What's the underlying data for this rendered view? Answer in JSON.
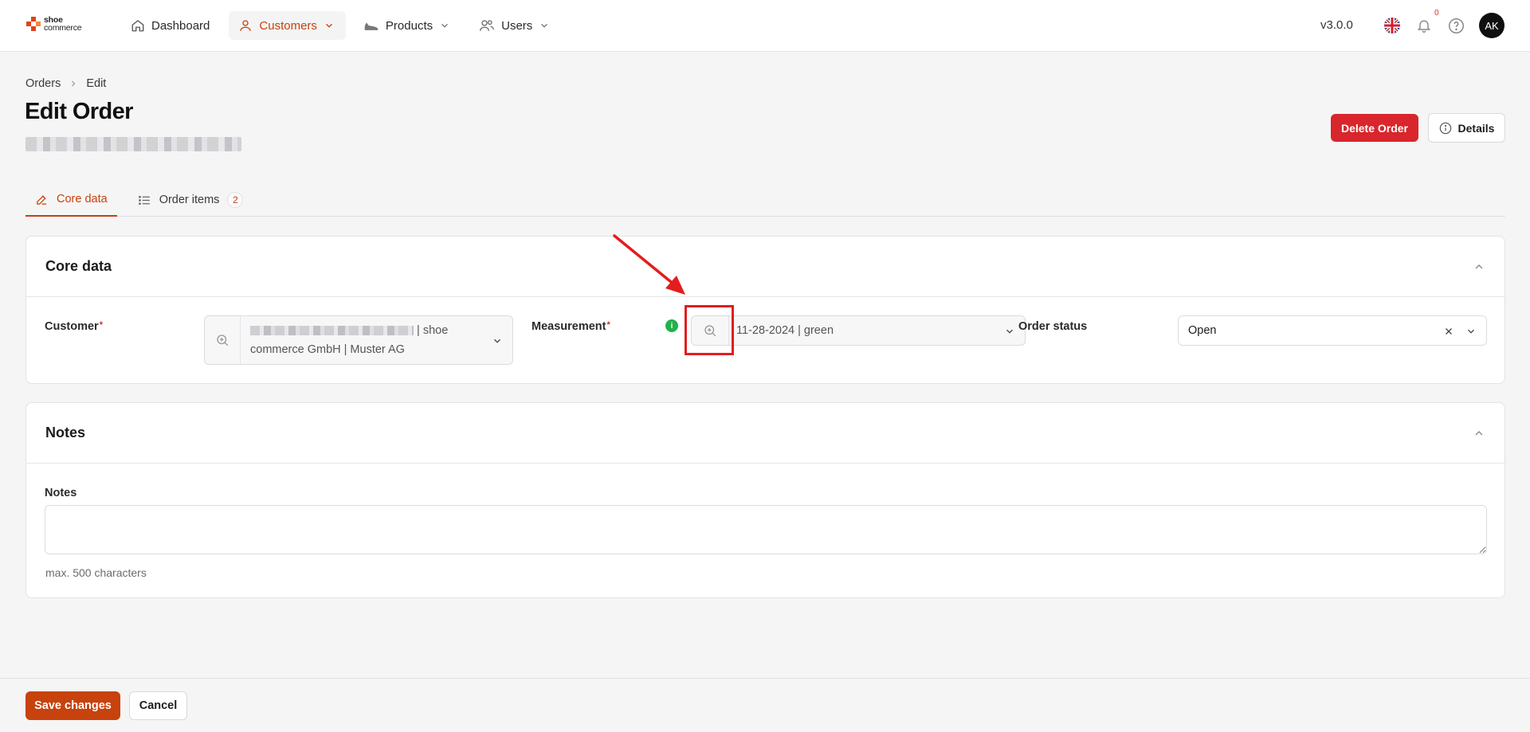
{
  "brand": {
    "line1": "shoe",
    "line2": "commerce"
  },
  "nav": {
    "dashboard": "Dashboard",
    "customers": "Customers",
    "products": "Products",
    "users": "Users"
  },
  "header": {
    "version": "v3.0.0",
    "notification_count": "0",
    "avatar_initials": "AK"
  },
  "breadcrumb": {
    "root": "Orders",
    "current": "Edit"
  },
  "page": {
    "title": "Edit Order",
    "delete_label": "Delete Order",
    "details_label": "Details"
  },
  "tabs": {
    "core": "Core data",
    "items": "Order items",
    "items_count": "2"
  },
  "core_card": {
    "title": "Core data",
    "customer_label": "Customer",
    "customer_value_line1_suffix": "| shoe",
    "customer_value_line2": "commerce GmbH | Muster AG",
    "measurement_label": "Measurement",
    "measurement_info": "i",
    "measurement_value": "11-28-2024 | green",
    "status_label": "Order status",
    "status_value": "Open",
    "required_mark": "*"
  },
  "notes_card": {
    "title": "Notes",
    "notes_label": "Notes",
    "notes_value": "",
    "helper": "max. 500 characters"
  },
  "footer": {
    "save_label": "Save changes",
    "cancel_label": "Cancel"
  },
  "colors": {
    "accent": "#c7420d",
    "danger": "#d8262c",
    "info": "#22b14c",
    "annotation": "#e31d1d"
  }
}
